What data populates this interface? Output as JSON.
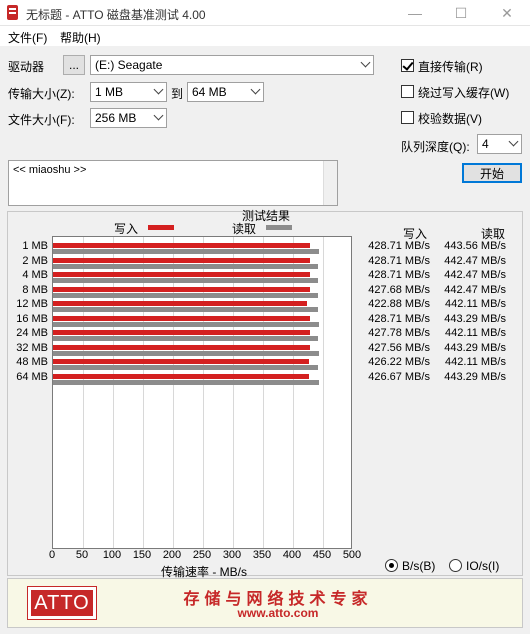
{
  "window": {
    "title": "无标题 - ATTO 磁盘基准测试 4.00",
    "minimize": "—",
    "maximize": "☐",
    "close": "✕"
  },
  "menu": {
    "file": "文件(F)",
    "help": "帮助(H)"
  },
  "controls": {
    "drive_label": "驱动器",
    "browse_label": "...",
    "drive_value": "(E:) Seagate",
    "transfer_label": "传输大小(Z):",
    "transfer_from": "1 MB",
    "to_label": "到",
    "transfer_to": "64 MB",
    "filesize_label": "文件大小(F):",
    "filesize_value": "256 MB",
    "direct_io_label": "直接传输(R)",
    "direct_io_checked": true,
    "bypass_cache_label": "绕过写入缓存(W)",
    "bypass_cache_checked": false,
    "verify_label": "校验数据(V)",
    "verify_checked": false,
    "queue_label": "队列深度(Q):",
    "queue_value": "4",
    "start_label": "开始",
    "description": "<< miaoshu >>"
  },
  "results": {
    "title": "测试结果",
    "legend_write": "写入",
    "legend_read": "读取",
    "col_write": "写入",
    "col_read": "读取",
    "xlabel": "传输速率 - MB/s",
    "unit_bytes": "B/s(B)",
    "unit_io": "IO/s(I)",
    "unit_selected": "bytes"
  },
  "chart_data": {
    "type": "bar",
    "orientation": "horizontal",
    "categories": [
      "1 MB",
      "2 MB",
      "4 MB",
      "8 MB",
      "12 MB",
      "16 MB",
      "24 MB",
      "32 MB",
      "48 MB",
      "64 MB"
    ],
    "series": [
      {
        "name": "写入",
        "values": [
          428.71,
          428.71,
          428.71,
          427.68,
          422.88,
          428.71,
          427.78,
          427.56,
          426.22,
          426.67
        ]
      },
      {
        "name": "读取",
        "values": [
          443.56,
          442.47,
          442.47,
          442.47,
          442.11,
          443.29,
          442.11,
          443.29,
          442.11,
          443.29
        ]
      }
    ],
    "write_labels": [
      "428.71 MB/s",
      "428.71 MB/s",
      "428.71 MB/s",
      "427.68 MB/s",
      "422.88 MB/s",
      "428.71 MB/s",
      "427.78 MB/s",
      "427.56 MB/s",
      "426.22 MB/s",
      "426.67 MB/s"
    ],
    "read_labels": [
      "443.56 MB/s",
      "442.47 MB/s",
      "442.47 MB/s",
      "442.47 MB/s",
      "442.11 MB/s",
      "443.29 MB/s",
      "442.11 MB/s",
      "443.29 MB/s",
      "442.11 MB/s",
      "443.29 MB/s"
    ],
    "xticks": [
      "0",
      "50",
      "100",
      "150",
      "200",
      "250",
      "300",
      "350",
      "400",
      "450",
      "500"
    ],
    "xlim": [
      0,
      500
    ],
    "xlabel": "传输速率 - MB/s",
    "grid": true,
    "colors": {
      "write": "#d42020",
      "read": "#8c8c8c"
    }
  },
  "banner": {
    "logo": "ATTO",
    "slogan": "存储与网络技术专家",
    "url": "www.atto.com"
  }
}
